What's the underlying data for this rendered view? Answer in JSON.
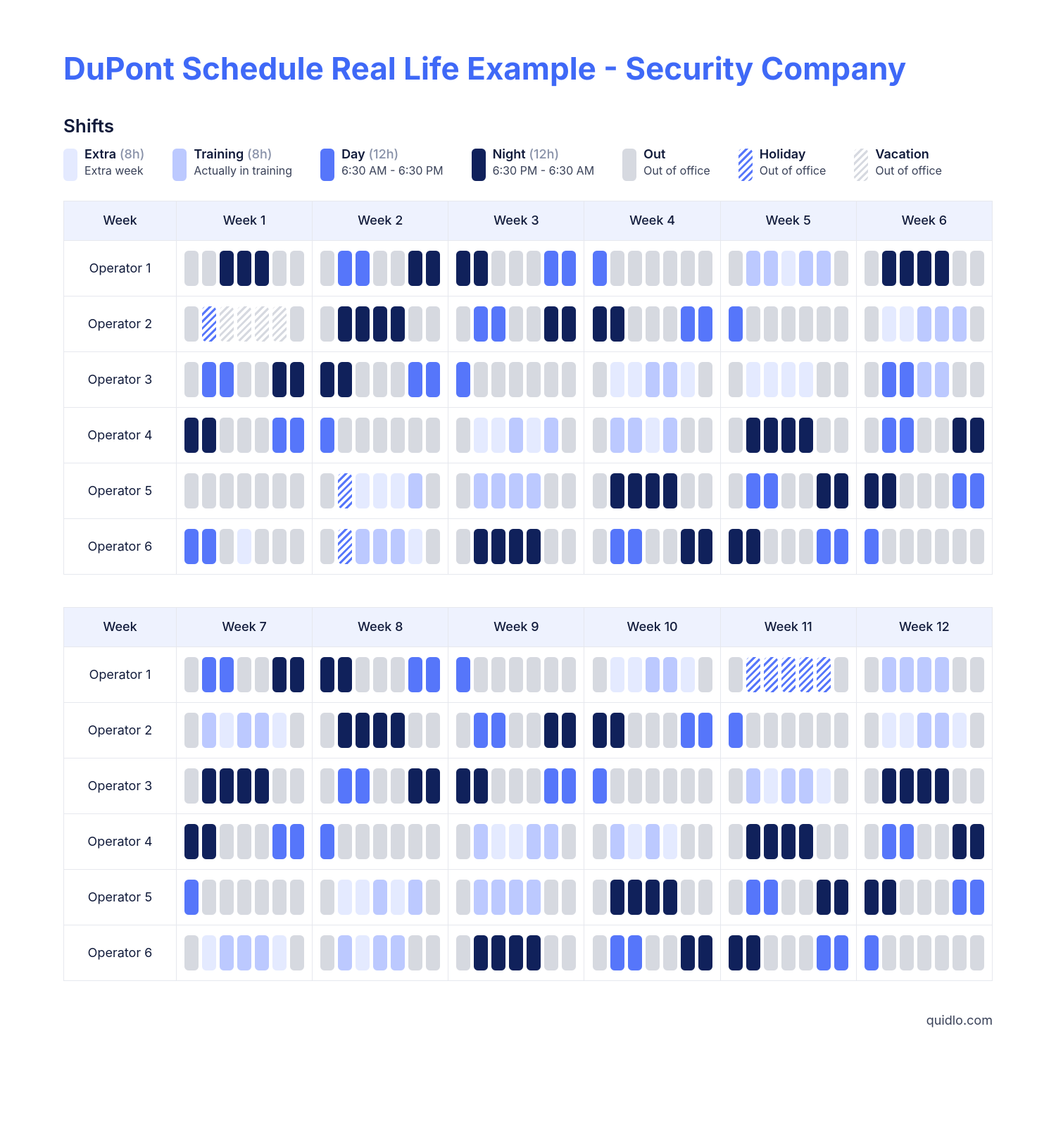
{
  "title": "DuPont Schedule Real Life Example - Security Company",
  "shifts_heading": "Shifts",
  "legend": [
    {
      "key": "extra",
      "cls": "c-extra",
      "name": "Extra",
      "duration": "(8h)",
      "sub": "Extra week"
    },
    {
      "key": "training",
      "cls": "c-training",
      "name": "Training",
      "duration": "(8h)",
      "sub": "Actually in training"
    },
    {
      "key": "day",
      "cls": "c-day",
      "name": "Day",
      "duration": "(12h)",
      "sub": "6:30 AM - 6:30 PM"
    },
    {
      "key": "night",
      "cls": "c-night",
      "name": "Night",
      "duration": "(12h)",
      "sub": "6:30 PM - 6:30 AM"
    },
    {
      "key": "out",
      "cls": "c-out",
      "name": "Out",
      "duration": "",
      "sub": "Out of office"
    },
    {
      "key": "holiday",
      "cls": "c-holiday",
      "name": "Holiday",
      "duration": "",
      "sub": "Out of office"
    },
    {
      "key": "vacation",
      "cls": "c-vacation",
      "name": "Vacation",
      "duration": "",
      "sub": "Out of office"
    }
  ],
  "row_header": "Week",
  "tables": [
    {
      "weeks": [
        "Week 1",
        "Week 2",
        "Week 3",
        "Week 4",
        "Week 5",
        "Week 6"
      ],
      "rows": [
        {
          "label": "Operator 1",
          "cells": [
            [
              "out",
              "out",
              "night",
              "night",
              "night",
              "out",
              "out"
            ],
            [
              "out",
              "day",
              "day",
              "out",
              "out",
              "night",
              "night"
            ],
            [
              "night",
              "night",
              "out",
              "out",
              "out",
              "day",
              "day"
            ],
            [
              "day",
              "out",
              "out",
              "out",
              "out",
              "out",
              "out"
            ],
            [
              "out",
              "training",
              "training",
              "extra",
              "training",
              "training",
              "out"
            ],
            [
              "out",
              "night",
              "night",
              "night",
              "night",
              "out",
              "out"
            ]
          ]
        },
        {
          "label": "Operator 2",
          "cells": [
            [
              "out",
              "holiday",
              "vacation",
              "vacation",
              "vacation",
              "vacation",
              "out"
            ],
            [
              "out",
              "night",
              "night",
              "night",
              "night",
              "out",
              "out"
            ],
            [
              "out",
              "day",
              "day",
              "out",
              "out",
              "night",
              "night"
            ],
            [
              "night",
              "night",
              "out",
              "out",
              "out",
              "day",
              "day"
            ],
            [
              "day",
              "out",
              "out",
              "out",
              "out",
              "out",
              "out"
            ],
            [
              "out",
              "extra",
              "extra",
              "training",
              "training",
              "training",
              "out"
            ]
          ]
        },
        {
          "label": "Operator 3",
          "cells": [
            [
              "out",
              "day",
              "day",
              "out",
              "out",
              "night",
              "night"
            ],
            [
              "night",
              "night",
              "out",
              "out",
              "out",
              "day",
              "day"
            ],
            [
              "day",
              "out",
              "out",
              "out",
              "out",
              "out",
              "out"
            ],
            [
              "out",
              "extra",
              "extra",
              "training",
              "training",
              "extra",
              "out"
            ],
            [
              "out",
              "extra",
              "extra",
              "extra",
              "extra",
              "out",
              "out"
            ],
            [
              "out",
              "day",
              "day",
              "training",
              "training",
              "out",
              "out"
            ]
          ]
        },
        {
          "label": "Operator 4",
          "cells": [
            [
              "night",
              "night",
              "out",
              "out",
              "out",
              "day",
              "day"
            ],
            [
              "day",
              "out",
              "out",
              "out",
              "out",
              "out",
              "out"
            ],
            [
              "out",
              "extra",
              "extra",
              "training",
              "extra",
              "training",
              "out"
            ],
            [
              "out",
              "training",
              "training",
              "extra",
              "training",
              "out",
              "out"
            ],
            [
              "out",
              "night",
              "night",
              "night",
              "night",
              "out",
              "out"
            ],
            [
              "out",
              "day",
              "day",
              "out",
              "out",
              "night",
              "night"
            ]
          ]
        },
        {
          "label": "Operator 5",
          "cells": [
            [
              "out",
              "out",
              "out",
              "out",
              "out",
              "out",
              "out"
            ],
            [
              "out",
              "holiday",
              "extra",
              "extra",
              "extra",
              "training",
              "out"
            ],
            [
              "out",
              "training",
              "training",
              "training",
              "training",
              "out",
              "out"
            ],
            [
              "out",
              "night",
              "night",
              "night",
              "night",
              "out",
              "out"
            ],
            [
              "out",
              "day",
              "day",
              "out",
              "out",
              "night",
              "night"
            ],
            [
              "night",
              "night",
              "out",
              "out",
              "out",
              "day",
              "day"
            ]
          ]
        },
        {
          "label": "Operator 6",
          "cells": [
            [
              "day",
              "day",
              "out",
              "extra",
              "out",
              "out",
              "out"
            ],
            [
              "out",
              "holiday",
              "training",
              "training",
              "training",
              "extra",
              "out"
            ],
            [
              "out",
              "night",
              "night",
              "night",
              "night",
              "out",
              "out"
            ],
            [
              "out",
              "day",
              "day",
              "out",
              "out",
              "night",
              "night"
            ],
            [
              "night",
              "night",
              "out",
              "out",
              "out",
              "day",
              "day"
            ],
            [
              "day",
              "out",
              "out",
              "out",
              "out",
              "out",
              "out"
            ]
          ]
        }
      ]
    },
    {
      "weeks": [
        "Week 7",
        "Week 8",
        "Week 9",
        "Week 10",
        "Week 11",
        "Week 12"
      ],
      "rows": [
        {
          "label": "Operator 1",
          "cells": [
            [
              "out",
              "day",
              "day",
              "out",
              "out",
              "night",
              "night"
            ],
            [
              "night",
              "night",
              "out",
              "out",
              "out",
              "day",
              "day"
            ],
            [
              "day",
              "out",
              "out",
              "out",
              "out",
              "out",
              "out"
            ],
            [
              "out",
              "extra",
              "extra",
              "training",
              "training",
              "extra",
              "out"
            ],
            [
              "out",
              "holiday",
              "holiday",
              "holiday",
              "holiday",
              "holiday",
              "out"
            ],
            [
              "out",
              "training",
              "training",
              "training",
              "training",
              "out",
              "out"
            ]
          ]
        },
        {
          "label": "Operator 2",
          "cells": [
            [
              "out",
              "training",
              "extra",
              "training",
              "training",
              "extra",
              "out"
            ],
            [
              "out",
              "night",
              "night",
              "night",
              "night",
              "out",
              "out"
            ],
            [
              "out",
              "day",
              "day",
              "out",
              "out",
              "night",
              "night"
            ],
            [
              "night",
              "night",
              "out",
              "out",
              "out",
              "day",
              "day"
            ],
            [
              "day",
              "out",
              "out",
              "out",
              "out",
              "out",
              "out"
            ],
            [
              "out",
              "extra",
              "extra",
              "training",
              "training",
              "extra",
              "out"
            ]
          ]
        },
        {
          "label": "Operator 3",
          "cells": [
            [
              "out",
              "night",
              "night",
              "night",
              "night",
              "out",
              "out"
            ],
            [
              "out",
              "day",
              "day",
              "out",
              "out",
              "night",
              "night"
            ],
            [
              "night",
              "night",
              "out",
              "out",
              "out",
              "day",
              "day"
            ],
            [
              "day",
              "out",
              "out",
              "out",
              "out",
              "out",
              "out"
            ],
            [
              "out",
              "training",
              "extra",
              "training",
              "training",
              "extra",
              "out"
            ],
            [
              "out",
              "night",
              "night",
              "night",
              "night",
              "out",
              "out"
            ]
          ]
        },
        {
          "label": "Operator 4",
          "cells": [
            [
              "night",
              "night",
              "out",
              "out",
              "out",
              "day",
              "day"
            ],
            [
              "day",
              "out",
              "out",
              "out",
              "out",
              "out",
              "out"
            ],
            [
              "out",
              "training",
              "extra",
              "extra",
              "training",
              "training",
              "out"
            ],
            [
              "out",
              "training",
              "extra",
              "training",
              "extra",
              "out",
              "out"
            ],
            [
              "out",
              "night",
              "night",
              "night",
              "night",
              "out",
              "out"
            ],
            [
              "out",
              "day",
              "day",
              "out",
              "out",
              "night",
              "night"
            ]
          ]
        },
        {
          "label": "Operator 5",
          "cells": [
            [
              "day",
              "out",
              "out",
              "out",
              "out",
              "out",
              "out"
            ],
            [
              "out",
              "extra",
              "extra",
              "training",
              "extra",
              "training",
              "out"
            ],
            [
              "out",
              "training",
              "training",
              "training",
              "training",
              "out",
              "out"
            ],
            [
              "out",
              "night",
              "night",
              "night",
              "night",
              "out",
              "out"
            ],
            [
              "out",
              "day",
              "day",
              "out",
              "out",
              "night",
              "night"
            ],
            [
              "night",
              "night",
              "out",
              "out",
              "out",
              "day",
              "day"
            ]
          ]
        },
        {
          "label": "Operator 6",
          "cells": [
            [
              "out",
              "extra",
              "training",
              "training",
              "training",
              "extra",
              "out"
            ],
            [
              "out",
              "training",
              "extra",
              "training",
              "training",
              "out",
              "out"
            ],
            [
              "out",
              "night",
              "night",
              "night",
              "night",
              "out",
              "out"
            ],
            [
              "out",
              "day",
              "day",
              "out",
              "out",
              "night",
              "night"
            ],
            [
              "night",
              "night",
              "out",
              "out",
              "out",
              "day",
              "day"
            ],
            [
              "day",
              "out",
              "out",
              "out",
              "out",
              "out",
              "out"
            ]
          ]
        }
      ]
    }
  ],
  "footer": "quidlo.com",
  "shift_classes": {
    "extra": "c-extra",
    "training": "c-training",
    "day": "c-day",
    "night": "c-night",
    "out": "c-out",
    "holiday": "c-holiday",
    "vacation": "c-vacation"
  }
}
